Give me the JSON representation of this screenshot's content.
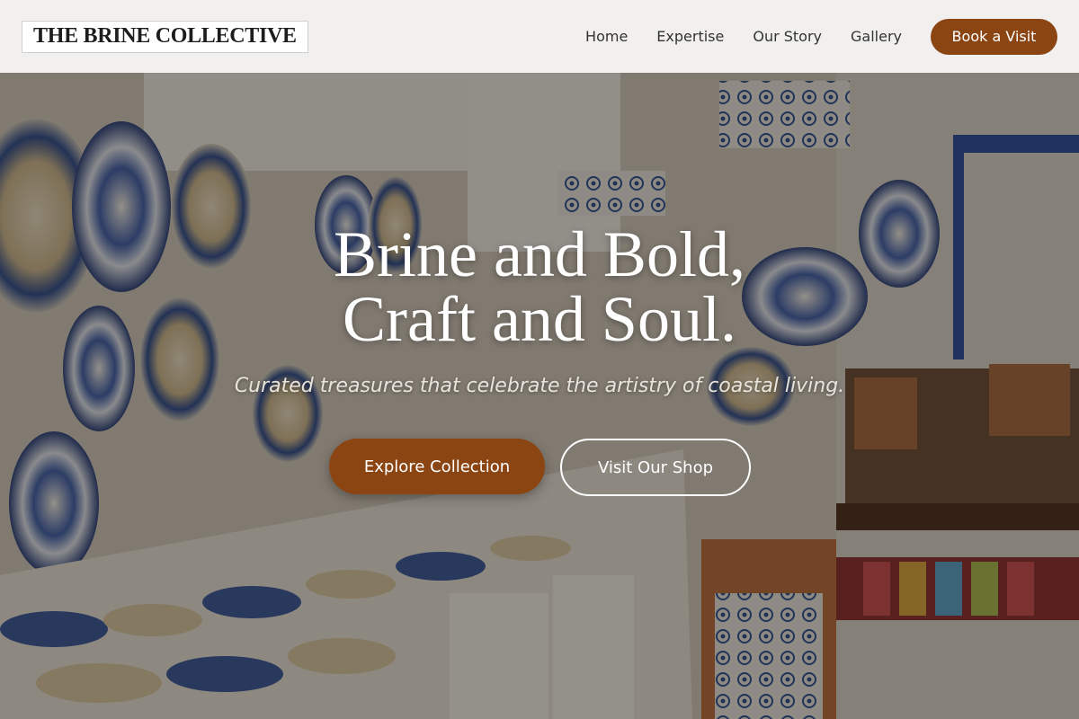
{
  "brand": {
    "name": "THE BRINE COLLECTIVE"
  },
  "nav": {
    "items": [
      {
        "label": "Home"
      },
      {
        "label": "Expertise"
      },
      {
        "label": "Our Story"
      },
      {
        "label": "Gallery"
      }
    ],
    "cta_label": "Book a Visit"
  },
  "hero": {
    "title_line1": "Brine and Bold,",
    "title_line2": "Craft and Soul.",
    "subtitle": "Curated treasures that celebrate the artistry of coastal living.",
    "primary_button": "Explore Collection",
    "secondary_button": "Visit Our Shop",
    "background_image": "ceramics-shop-interior"
  },
  "colors": {
    "accent": "#8b4513",
    "header_bg": "#faf9f7",
    "text_dark": "#333333",
    "hero_text": "#ffffff"
  }
}
